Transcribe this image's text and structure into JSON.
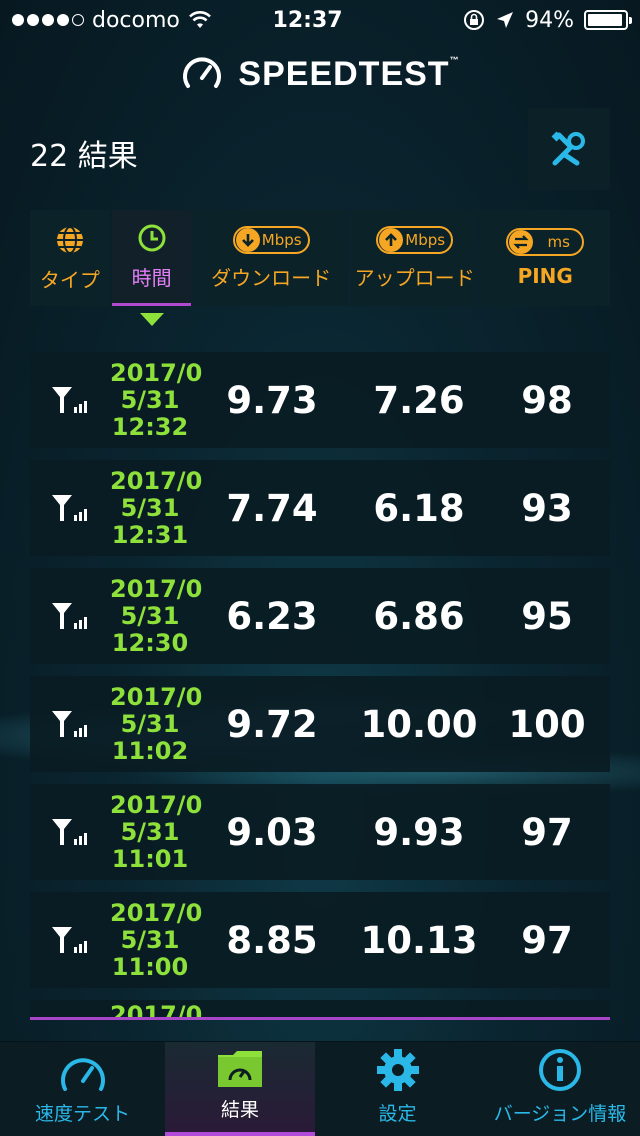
{
  "status_bar": {
    "carrier": "docomo",
    "time": "12:37",
    "battery": "94%",
    "signal_dots_filled": 4,
    "signal_dots_total": 5
  },
  "header": {
    "logo_text": "SPEEDTEST",
    "trademark": "™"
  },
  "results": {
    "count_label": "22 結果"
  },
  "columns": {
    "type": {
      "label": "タイプ"
    },
    "time": {
      "label": "時間"
    },
    "download": {
      "label": "ダウンロード",
      "unit": "Mbps"
    },
    "upload": {
      "label": "アップロード",
      "unit": "Mbps"
    },
    "ping": {
      "label": "PING",
      "unit": "ms"
    }
  },
  "rows": [
    {
      "date_line1": "2017/0",
      "date_line2": "5/31",
      "date_line3": "12:32",
      "download": "9.73",
      "upload": "7.26",
      "ping": "98"
    },
    {
      "date_line1": "2017/0",
      "date_line2": "5/31",
      "date_line3": "12:31",
      "download": "7.74",
      "upload": "6.18",
      "ping": "93"
    },
    {
      "date_line1": "2017/0",
      "date_line2": "5/31",
      "date_line3": "12:30",
      "download": "6.23",
      "upload": "6.86",
      "ping": "95"
    },
    {
      "date_line1": "2017/0",
      "date_line2": "5/31",
      "date_line3": "11:02",
      "download": "9.72",
      "upload": "10.00",
      "ping": "100"
    },
    {
      "date_line1": "2017/0",
      "date_line2": "5/31",
      "date_line3": "11:01",
      "download": "9.03",
      "upload": "9.93",
      "ping": "97"
    },
    {
      "date_line1": "2017/0",
      "date_line2": "5/31",
      "date_line3": "11:00",
      "download": "8.85",
      "upload": "10.13",
      "ping": "97"
    }
  ],
  "partial_row": {
    "date_line1": "2017/0"
  },
  "tabs": [
    {
      "label": "速度テスト",
      "icon": "speedometer-icon"
    },
    {
      "label": "結果",
      "icon": "results-folder-icon"
    },
    {
      "label": "設定",
      "icon": "gear-icon"
    },
    {
      "label": "バージョン情報",
      "icon": "info-icon"
    }
  ],
  "colors": {
    "accent_orange": "#f5a623",
    "accent_green": "#8ee13b",
    "accent_purple": "#b24ad0",
    "accent_blue": "#2ab8e8"
  }
}
